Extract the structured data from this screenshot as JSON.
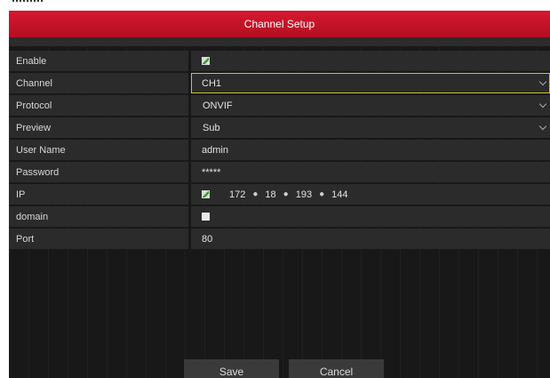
{
  "dialog": {
    "title": "Channel Setup"
  },
  "form": {
    "enable": {
      "label": "Enable",
      "checked": true
    },
    "channel": {
      "label": "Channel",
      "value": "CH1"
    },
    "protocol": {
      "label": "Protocol",
      "value": "ONVIF"
    },
    "preview": {
      "label": "Preview",
      "value": "Sub"
    },
    "username": {
      "label": "User Name",
      "value": "admin"
    },
    "password": {
      "label": "Password",
      "value": "*****"
    },
    "ip": {
      "label": "IP",
      "checked": true,
      "octets": [
        "172",
        "18",
        "193",
        "144"
      ]
    },
    "domain": {
      "label": "domain",
      "checked": false
    },
    "port": {
      "label": "Port",
      "value": "80"
    }
  },
  "buttons": {
    "save": "Save",
    "cancel": "Cancel"
  },
  "colors": {
    "title_red": "#c8142a",
    "focus_yellow": "#d6c12a",
    "check_green": "#3a9d2f"
  }
}
